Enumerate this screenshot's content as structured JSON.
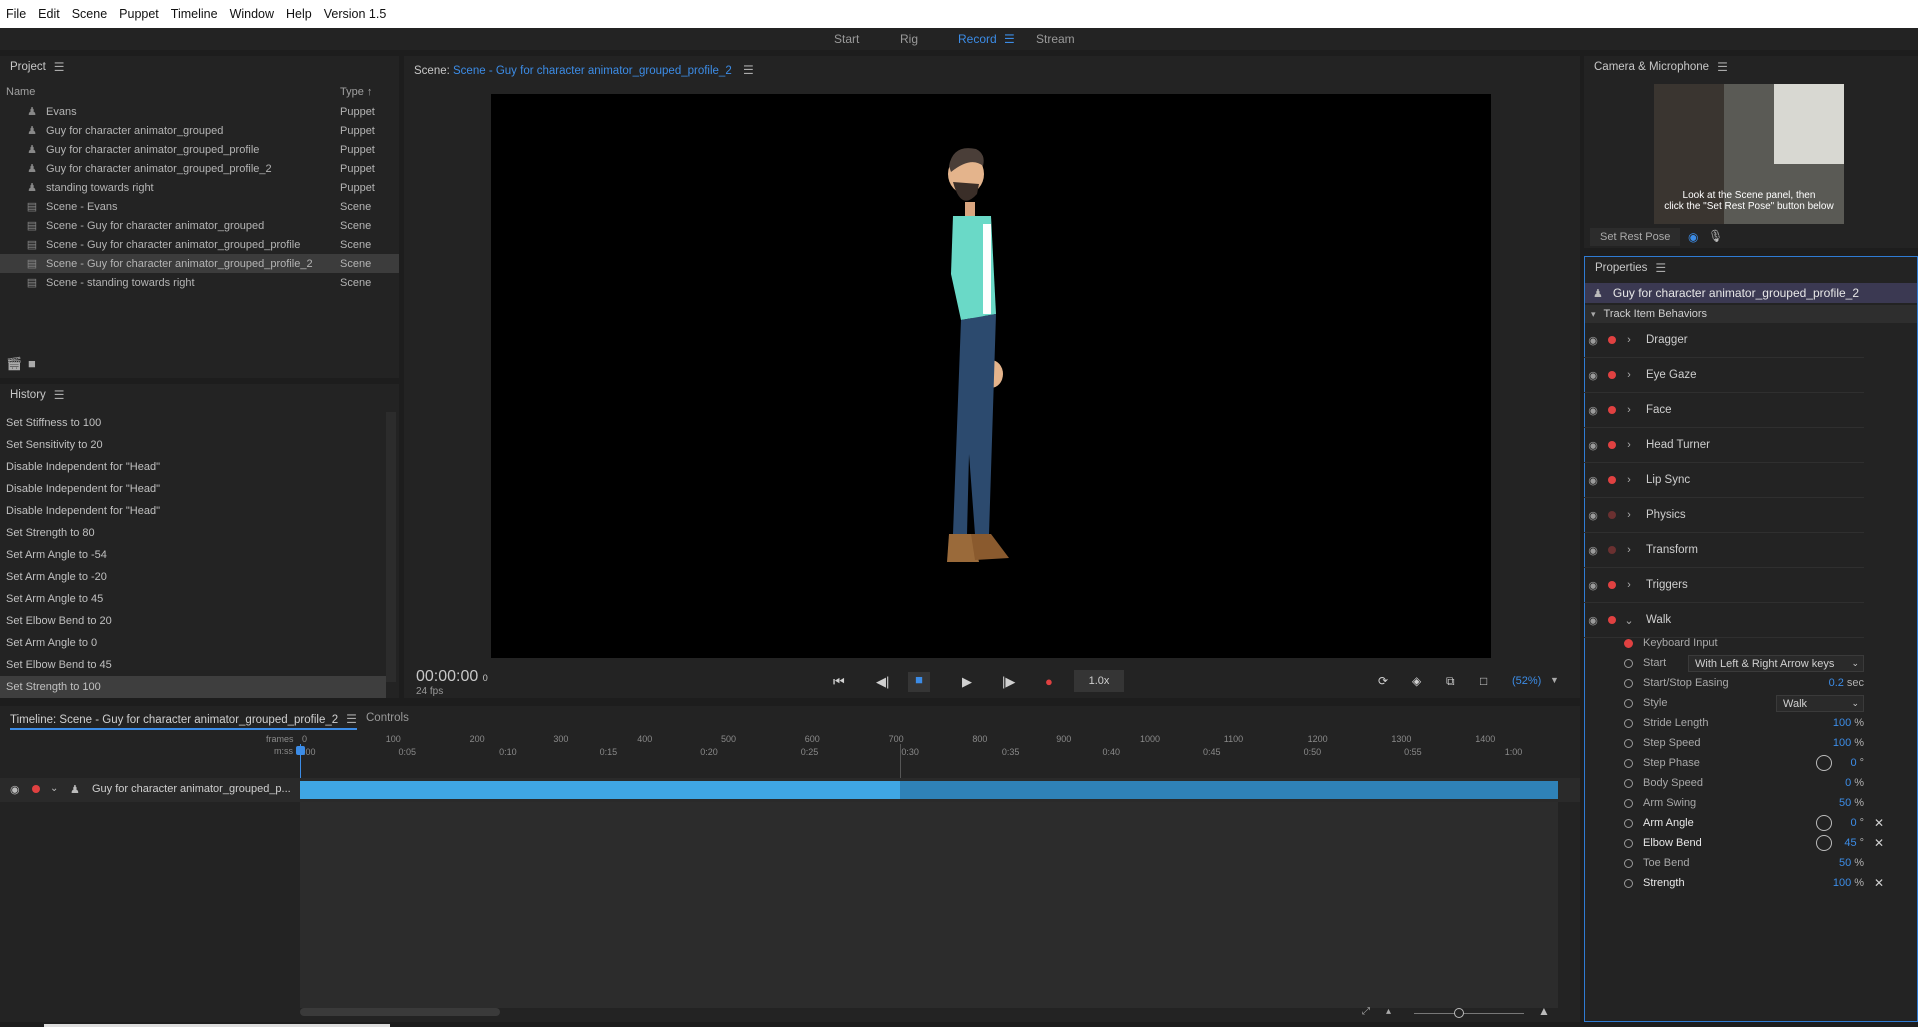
{
  "menu": [
    "File",
    "Edit",
    "Scene",
    "Puppet",
    "Timeline",
    "Window",
    "Help",
    "Version 1.5"
  ],
  "workspaces": {
    "start": "Start",
    "rig": "Rig",
    "record": "Record",
    "stream": "Stream"
  },
  "project": {
    "title": "Project",
    "col_name": "Name",
    "col_type": "Type",
    "items": [
      {
        "name": "Evans",
        "type": "Puppet"
      },
      {
        "name": "Guy for character animator_grouped",
        "type": "Puppet"
      },
      {
        "name": "Guy for character animator_grouped_profile",
        "type": "Puppet"
      },
      {
        "name": "Guy for character animator_grouped_profile_2",
        "type": "Puppet"
      },
      {
        "name": "standing towards right",
        "type": "Puppet"
      },
      {
        "name": "Scene - Evans",
        "type": "Scene"
      },
      {
        "name": "Scene - Guy for character animator_grouped",
        "type": "Scene"
      },
      {
        "name": "Scene - Guy for character animator_grouped_profile",
        "type": "Scene"
      },
      {
        "name": "Scene - Guy for character animator_grouped_profile_2",
        "type": "Scene"
      },
      {
        "name": "Scene - standing towards right",
        "type": "Scene"
      }
    ]
  },
  "history": {
    "title": "History",
    "items": [
      "Set Stiffness to 100",
      "Set Sensitivity to 20",
      "Disable Independent for \"Head\"",
      "Disable Independent for \"Head\"",
      "Disable Independent for \"Head\"",
      "Set Strength to 80",
      "Set Arm Angle to -54",
      "Set Arm Angle to -20",
      "Set Arm Angle to 45",
      "Set Elbow Bend to 20",
      "Set Arm Angle to 0",
      "Set Elbow Bend to 45",
      "Set Strength to 100"
    ]
  },
  "scene": {
    "label": "Scene:",
    "name": "Scene - Guy for character animator_grouped_profile_2",
    "timecode": "00:00:00",
    "frame": "0",
    "fps": "24 fps",
    "speed": "1.0x",
    "zoom": "(52%)"
  },
  "camera": {
    "title": "Camera & Microphone",
    "hint_line1": "Look at the Scene panel, then",
    "hint_line2": "click the \"Set Rest Pose\" button below",
    "rest_pose": "Set Rest Pose"
  },
  "properties": {
    "title": "Properties",
    "puppet": "Guy for character animator_grouped_profile_2",
    "section": "Track Item Behaviors",
    "behaviors": [
      "Dragger",
      "Eye Gaze",
      "Face",
      "Head Turner",
      "Lip Sync",
      "Physics",
      "Transform",
      "Triggers",
      "Walk"
    ],
    "walk_params": {
      "keyboard_input": "Keyboard Input",
      "start_label": "Start",
      "start_value": "With Left & Right Arrow keys",
      "easing_label": "Start/Stop Easing",
      "easing_value": "0.2",
      "easing_unit": "sec",
      "style_label": "Style",
      "style_value": "Walk",
      "stride_label": "Stride Length",
      "stride_value": "100",
      "stride_unit": "%",
      "step_speed_label": "Step Speed",
      "step_speed_value": "100",
      "step_speed_unit": "%",
      "step_phase_label": "Step Phase",
      "step_phase_value": "0",
      "step_phase_unit": "°",
      "body_speed_label": "Body Speed",
      "body_speed_value": "0",
      "body_speed_unit": "%",
      "arm_swing_label": "Arm Swing",
      "arm_swing_value": "50",
      "arm_swing_unit": "%",
      "arm_angle_label": "Arm Angle",
      "arm_angle_value": "0",
      "arm_angle_unit": "°",
      "elbow_label": "Elbow Bend",
      "elbow_value": "45",
      "elbow_unit": "°",
      "toe_label": "Toe Bend",
      "toe_value": "50",
      "toe_unit": "%",
      "strength_label": "Strength",
      "strength_value": "100",
      "strength_unit": "%"
    }
  },
  "timeline": {
    "title": "Timeline: Scene - Guy for character animator_grouped_profile_2",
    "controls_tab": "Controls",
    "frames_label": "frames",
    "mss_label": "m:ss",
    "frame_ticks": [
      "0",
      "100",
      "200",
      "300",
      "400",
      "500",
      "600",
      "700",
      "800",
      "900",
      "1000",
      "1100",
      "1200",
      "1300",
      "1400"
    ],
    "time_ticks": [
      "0:00",
      "0:05",
      "0:10",
      "0:15",
      "0:20",
      "0:25",
      "0:30",
      "0:35",
      "0:40",
      "0:45",
      "0:50",
      "0:55",
      "1:00"
    ],
    "track_name": "Guy for character animator_grouped_p..."
  }
}
